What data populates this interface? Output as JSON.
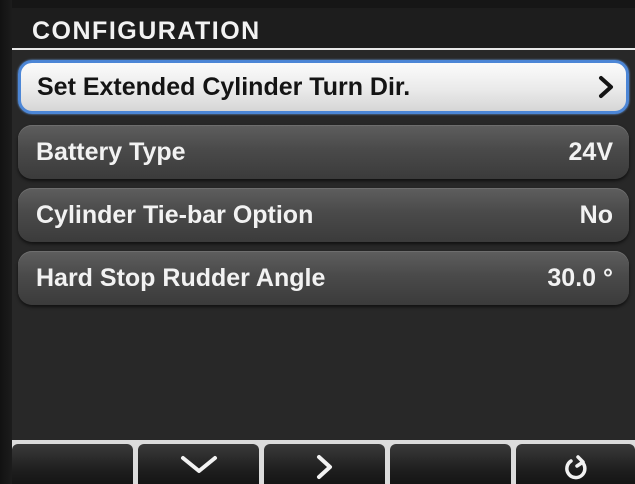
{
  "header": {
    "title": "CONFIGURATION"
  },
  "menu": {
    "items": [
      {
        "label": "Set Extended Cylinder Turn Dir.",
        "value": "",
        "has_submenu": true,
        "selected": true
      },
      {
        "label": "Battery Type",
        "value": "24V",
        "has_submenu": false,
        "selected": false
      },
      {
        "label": "Cylinder Tie-bar Option",
        "value": "No",
        "has_submenu": false,
        "selected": false
      },
      {
        "label": "Hard Stop Rudder Angle",
        "value": "30.0 °",
        "has_submenu": false,
        "selected": false
      }
    ]
  },
  "softkeys": [
    {
      "icon": ""
    },
    {
      "icon": "chevron-down-icon"
    },
    {
      "icon": "chevron-right-icon"
    },
    {
      "icon": ""
    },
    {
      "icon": "back-arrow-icon"
    }
  ],
  "colors": {
    "selection_border": "#4c86d6",
    "row_background": "#4a4a4a",
    "header_background": "#1d1d1d",
    "text": "#f2f2f2"
  }
}
